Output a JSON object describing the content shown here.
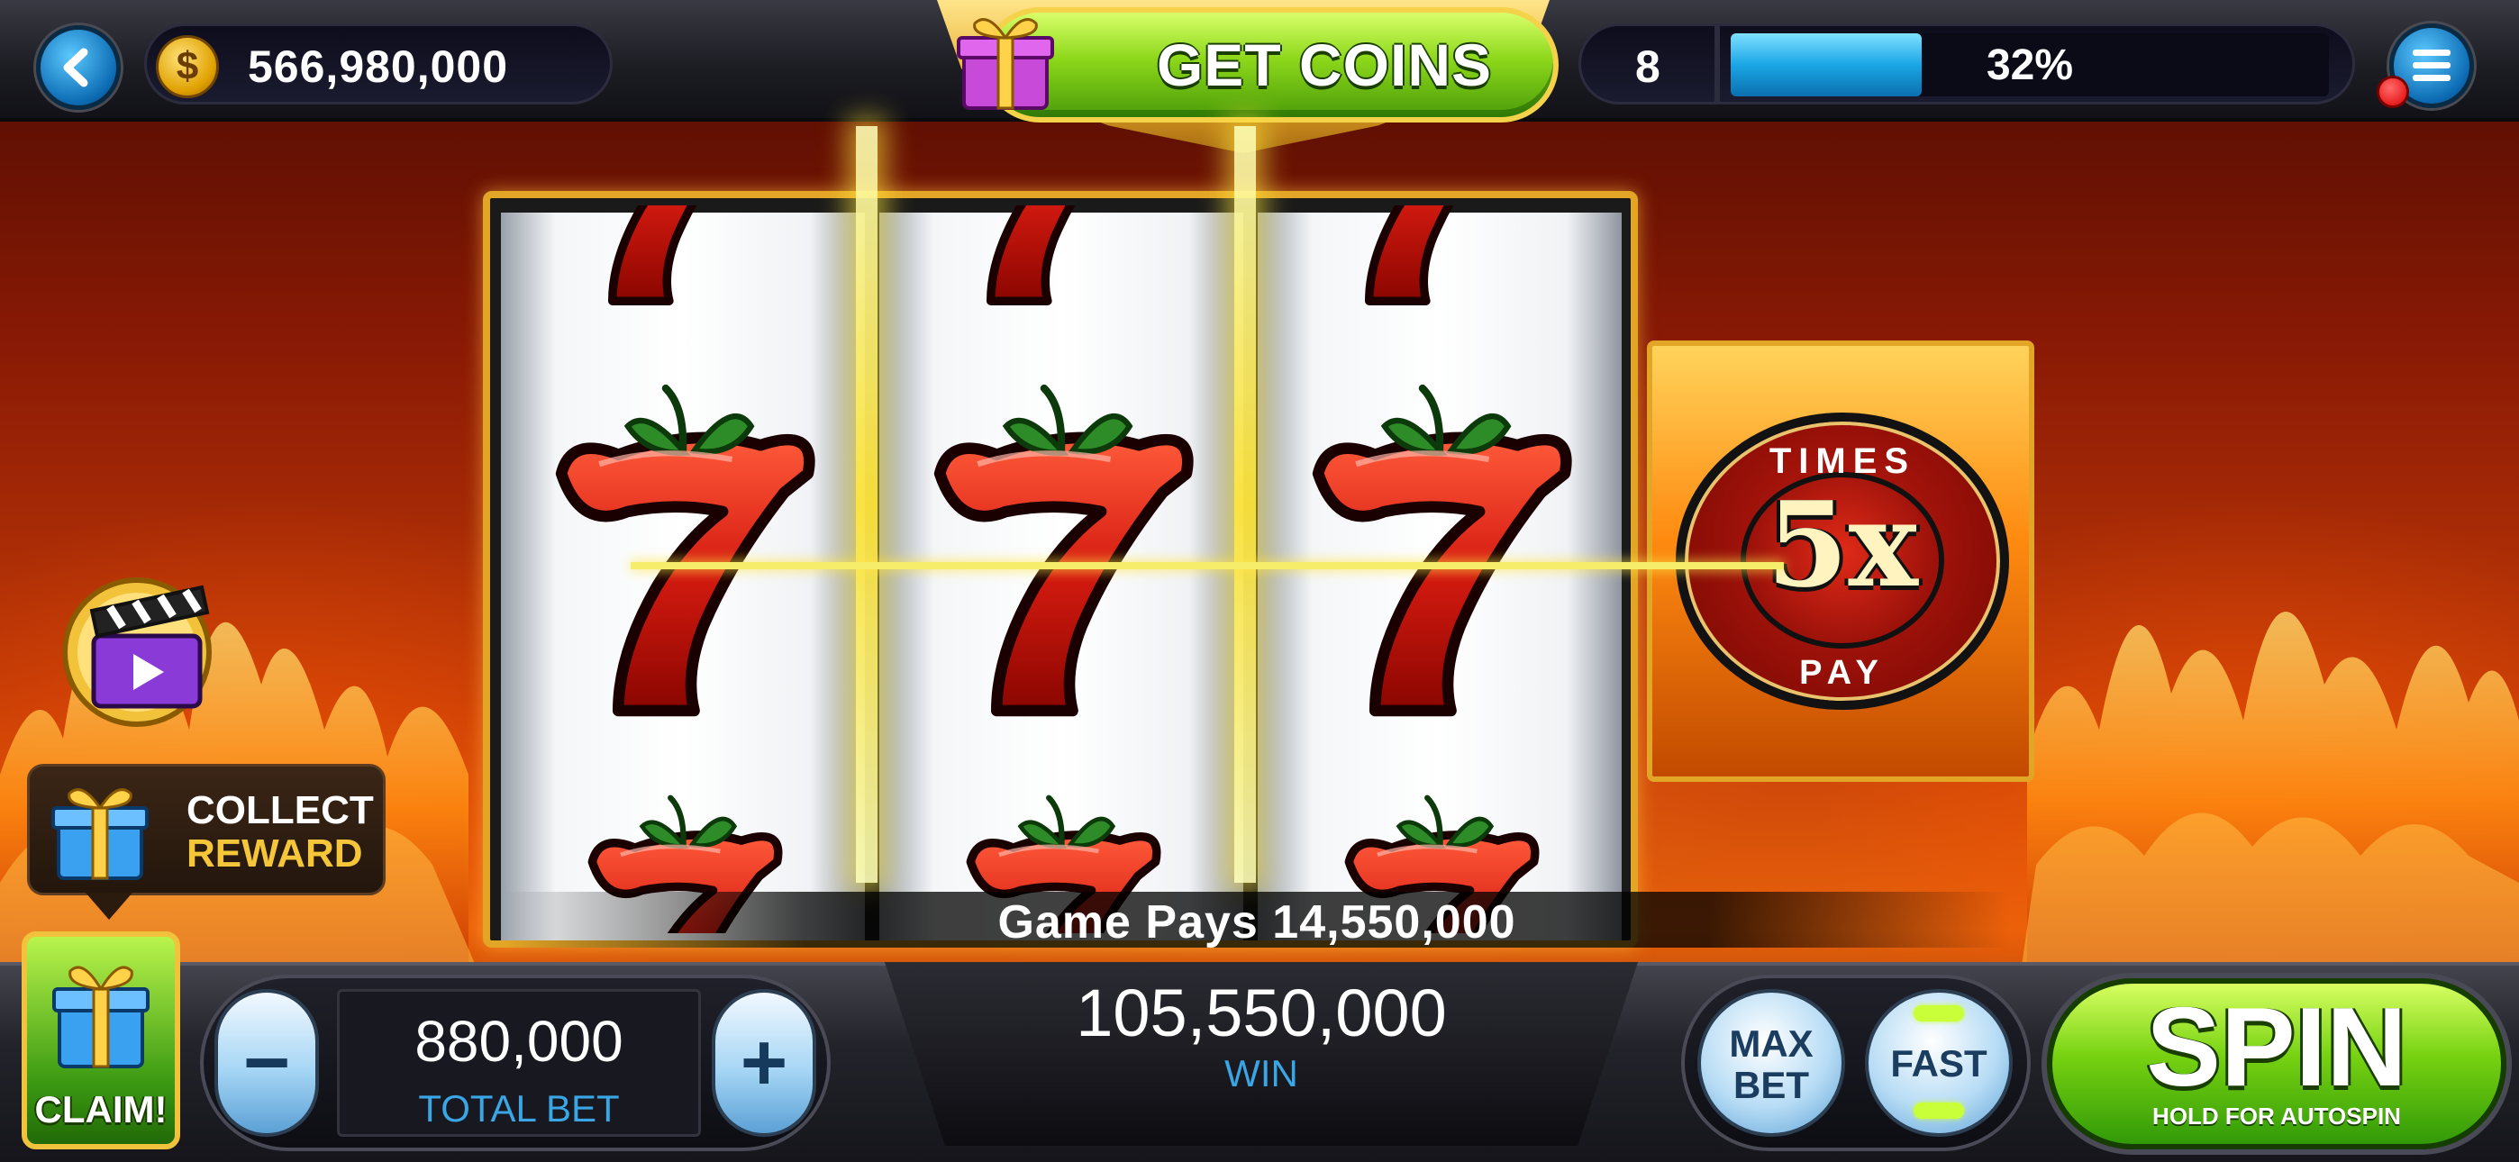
{
  "header": {
    "back_icon": "back-arrow-icon",
    "coin_icon": "dollar-coin-icon",
    "coin_symbol": "$",
    "balance": "566,980,000",
    "get_coins_label": "GET COINS",
    "gift_icon": "gift-icon",
    "level": "8",
    "progress_percent": 32,
    "progress_label": "32%",
    "menu_icon": "hamburger-menu-icon",
    "has_notification": true
  },
  "reels": {
    "symbol": "red-seven-with-leaves",
    "count": 3,
    "rows_visible": 3
  },
  "multiplier": {
    "top_text": "TIMES",
    "value": "5x",
    "bottom_text": "PAY"
  },
  "win_banner": {
    "text": "Game Pays 14,550,000"
  },
  "side": {
    "video_icon": "clapperboard-video-icon",
    "reward_line1": "COLLECT",
    "reward_line2": "REWARD",
    "claim_label": "CLAIM!"
  },
  "controls": {
    "minus_label": "−",
    "plus_label": "+",
    "total_bet_value": "880,000",
    "total_bet_label": "TOTAL BET",
    "win_value": "105,550,000",
    "win_label": "WIN",
    "max_bet_line1": "MAX",
    "max_bet_line2": "BET",
    "fast_label": "FAST",
    "spin_label": "SPIN",
    "spin_sub": "HOLD FOR AUTOSPIN"
  },
  "colors": {
    "accent_green": "#77d211",
    "accent_blue": "#1aa6e6",
    "gold_frame": "#e3a526",
    "seven_red": "#d41a10"
  }
}
